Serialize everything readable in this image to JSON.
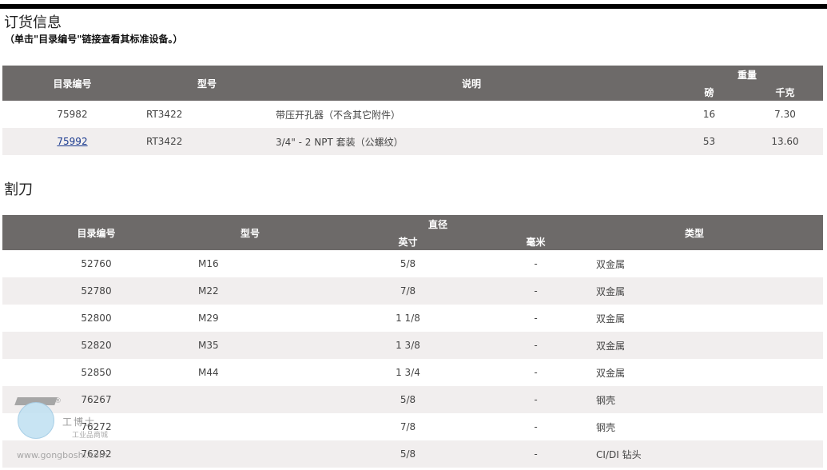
{
  "page": {
    "title": "订货信息",
    "subtitle": "（单击\"目录编号\"链接查看其标准设备。）",
    "section2_title": "割刀"
  },
  "table1": {
    "headers": {
      "catalog": "目录编号",
      "model": "型号",
      "desc": "说明",
      "weight": "重量",
      "lb": "磅",
      "kg": "千克"
    },
    "rows": [
      {
        "catalog": "75982",
        "model": "RT3422",
        "desc": "带压开孔器（不含其它附件）",
        "lb": "16",
        "kg": "7.30",
        "link": false
      },
      {
        "catalog": "75992",
        "model": "RT3422",
        "desc": "3/4\" - 2 NPT 套装（公螺纹）",
        "lb": "53",
        "kg": "13.60",
        "link": true
      }
    ]
  },
  "table2": {
    "headers": {
      "catalog": "目录编号",
      "model": "型号",
      "diameter": "直径",
      "inch": "英寸",
      "mm": "毫米",
      "type": "类型"
    },
    "rows": [
      {
        "catalog": "52760",
        "model": "M16",
        "inch": "5/8",
        "mm": "-",
        "type": "双金属"
      },
      {
        "catalog": "52780",
        "model": "M22",
        "inch": "7/8",
        "mm": "-",
        "type": "双金属"
      },
      {
        "catalog": "52800",
        "model": "M29",
        "inch": "1 1/8",
        "mm": "-",
        "type": "双金属"
      },
      {
        "catalog": "52820",
        "model": "M35",
        "inch": "1 3/8",
        "mm": "-",
        "type": "双金属"
      },
      {
        "catalog": "52850",
        "model": "M44",
        "inch": "1 3/4",
        "mm": "-",
        "type": "双金属"
      },
      {
        "catalog": "76267",
        "model": "",
        "inch": "5/8",
        "mm": "-",
        "type": "钢壳"
      },
      {
        "catalog": "76272",
        "model": "",
        "inch": "7/8",
        "mm": "-",
        "type": "钢壳"
      },
      {
        "catalog": "76292",
        "model": "",
        "inch": "5/8",
        "mm": "-",
        "type": "CI/DI 钻头"
      }
    ]
  },
  "watermark": {
    "registered": "®",
    "title": "工博士",
    "subtitle": "工业品商城",
    "url": "www.gongboshi.com"
  },
  "colors": {
    "header_bg": "#6d6a69",
    "alt_row_bg": "#f1eeee",
    "link": "#1a3a8f",
    "top_bar": "#000000"
  }
}
